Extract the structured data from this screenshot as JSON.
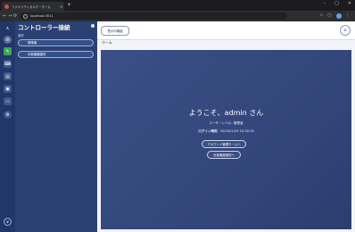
{
  "browser": {
    "tab_title": "ファシリティカルテ・ホーム",
    "tab_close": "×",
    "new_tab": "+",
    "url": "localhost:3011",
    "window_controls": {
      "minimize": "–",
      "maximize": "□",
      "close": "✕"
    },
    "nav": {
      "back": "←",
      "forward": "→",
      "reload": "⟳"
    },
    "icons": {
      "star": "☆",
      "extensions": "▢",
      "menu": "⋮"
    }
  },
  "rail": {
    "buttons": [
      {
        "icon": "chevron-up-icon",
        "glyph": "∧"
      },
      {
        "icon": "no-entry-icon",
        "glyph": "⊘"
      },
      {
        "icon": "pen-icon",
        "glyph": "✎"
      },
      {
        "icon": "keyboard-icon",
        "glyph": "⌨"
      },
      {
        "icon": "document-icon",
        "glyph": "▤"
      },
      {
        "icon": "image-icon",
        "glyph": "▣"
      },
      {
        "icon": "monitor-icon",
        "glyph": "▭"
      },
      {
        "icon": "gear-icon",
        "glyph": "⚙"
      },
      {
        "icon": "chevron-down-icon",
        "glyph": "∨"
      }
    ]
  },
  "sidebar": {
    "title": "コントローラー接続",
    "section": "選択",
    "items": [
      {
        "label": "昇降機"
      },
      {
        "label": "対象機器選択"
      }
    ]
  },
  "main": {
    "topbar_button": "表示中機能",
    "home_icon": "⌂",
    "page_title": "ホーム",
    "welcome": "ようこそ、admin さん",
    "user_level": "ユーザ・レベル: 管理者",
    "login_label": "ログイン時刻",
    "login_time": "2025/01/09 10:30:34",
    "buttons": [
      {
        "label": "アカウント管理ホームへ"
      },
      {
        "label": "対象機器選択へ"
      }
    ]
  },
  "colors": {
    "rail": "#22366a",
    "sidebar": "#2b4174",
    "card": "#34477c",
    "page_bg": "#f3f4f7"
  }
}
